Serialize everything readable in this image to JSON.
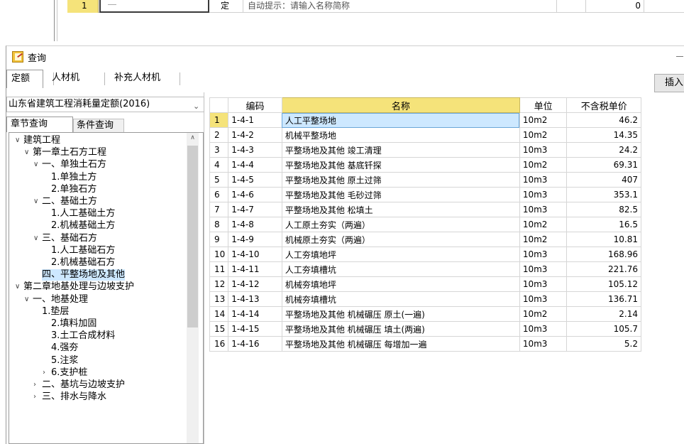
{
  "background_row": {
    "row_number": "1",
    "type_label": "定",
    "hint": "自动提示：请输入名称简称",
    "value": "0"
  },
  "dialog": {
    "title": "查询",
    "top_tabs": [
      "定额",
      "人材机",
      "补充人材机"
    ],
    "insert_button": "插入",
    "database_select": "山东省建筑工程消耗量定额(2016)",
    "sub_tabs": [
      "章节查询",
      "条件查询"
    ]
  },
  "tree": [
    {
      "label": "建筑工程",
      "expand": "open"
    },
    {
      "label": "第一章土石方工程",
      "expand": "open"
    },
    {
      "label": "一、单独土石方",
      "expand": "open"
    },
    {
      "label": "1.单独土方",
      "expand": "none"
    },
    {
      "label": "2.单独石方",
      "expand": "none"
    },
    {
      "label": "二、基础土方",
      "expand": "open"
    },
    {
      "label": "1.人工基础土方",
      "expand": "none"
    },
    {
      "label": "2.机械基础土方",
      "expand": "none"
    },
    {
      "label": "三、基础石方",
      "expand": "open"
    },
    {
      "label": "1.人工基础石方",
      "expand": "none"
    },
    {
      "label": "2.机械基础石方",
      "expand": "none"
    },
    {
      "label": "四、平整场地及其他",
      "expand": "none",
      "selected": true
    },
    {
      "label": "第二章地基处理与边坡支护",
      "expand": "open"
    },
    {
      "label": "一、地基处理",
      "expand": "open"
    },
    {
      "label": "1.垫层",
      "expand": "none"
    },
    {
      "label": "2.填料加固",
      "expand": "none"
    },
    {
      "label": "3.土工合成材料",
      "expand": "none"
    },
    {
      "label": "4.强夯",
      "expand": "none"
    },
    {
      "label": "5.注浆",
      "expand": "none"
    },
    {
      "label": "6.支护桩",
      "expand": "closed"
    },
    {
      "label": "二、基坑与边坡支护",
      "expand": "closed"
    },
    {
      "label": "三、排水与降水",
      "expand": "closed"
    }
  ],
  "grid": {
    "headers": [
      "",
      "编码",
      "名称",
      "单位",
      "不含税单价"
    ],
    "rows": [
      {
        "n": "1",
        "code": "1-4-1",
        "name": "人工平整场地",
        "unit": "10m2",
        "price": "46.2"
      },
      {
        "n": "2",
        "code": "1-4-2",
        "name": "机械平整场地",
        "unit": "10m2",
        "price": "14.35"
      },
      {
        "n": "3",
        "code": "1-4-3",
        "name": "平整场地及其他 竣工清理",
        "unit": "10m3",
        "price": "24.2"
      },
      {
        "n": "4",
        "code": "1-4-4",
        "name": "平整场地及其他 基底钎探",
        "unit": "10m2",
        "price": "69.31"
      },
      {
        "n": "5",
        "code": "1-4-5",
        "name": "平整场地及其他 原土过筛",
        "unit": "10m3",
        "price": "407"
      },
      {
        "n": "6",
        "code": "1-4-6",
        "name": "平整场地及其他 毛砂过筛",
        "unit": "10m3",
        "price": "353.1"
      },
      {
        "n": "7",
        "code": "1-4-7",
        "name": "平整场地及其他 松填土",
        "unit": "10m3",
        "price": "82.5"
      },
      {
        "n": "8",
        "code": "1-4-8",
        "name": "人工原土夯实（两遍）",
        "unit": "10m2",
        "price": "16.5"
      },
      {
        "n": "9",
        "code": "1-4-9",
        "name": "机械原土夯实（两遍）",
        "unit": "10m2",
        "price": "10.81"
      },
      {
        "n": "10",
        "code": "1-4-10",
        "name": "人工夯填地坪",
        "unit": "10m3",
        "price": "168.96"
      },
      {
        "n": "11",
        "code": "1-4-11",
        "name": "人工夯填槽坑",
        "unit": "10m3",
        "price": "221.76"
      },
      {
        "n": "12",
        "code": "1-4-12",
        "name": "机械夯填地坪",
        "unit": "10m3",
        "price": "105.12"
      },
      {
        "n": "13",
        "code": "1-4-13",
        "name": "机械夯填槽坑",
        "unit": "10m3",
        "price": "136.71"
      },
      {
        "n": "14",
        "code": "1-4-14",
        "name": "平整场地及其他 机械碾压 原土(一遍)",
        "unit": "10m2",
        "price": "2.14"
      },
      {
        "n": "15",
        "code": "1-4-15",
        "name": "平整场地及其他 机械碾压 填土(两遍)",
        "unit": "10m3",
        "price": "105.7"
      },
      {
        "n": "16",
        "code": "1-4-16",
        "name": "平整场地及其他 机械碾压 每增加一遍",
        "unit": "10m3",
        "price": "5.2"
      }
    ]
  },
  "colors": {
    "selection_blue": "#cde8ff",
    "header_yellow": "#f5e37a"
  }
}
